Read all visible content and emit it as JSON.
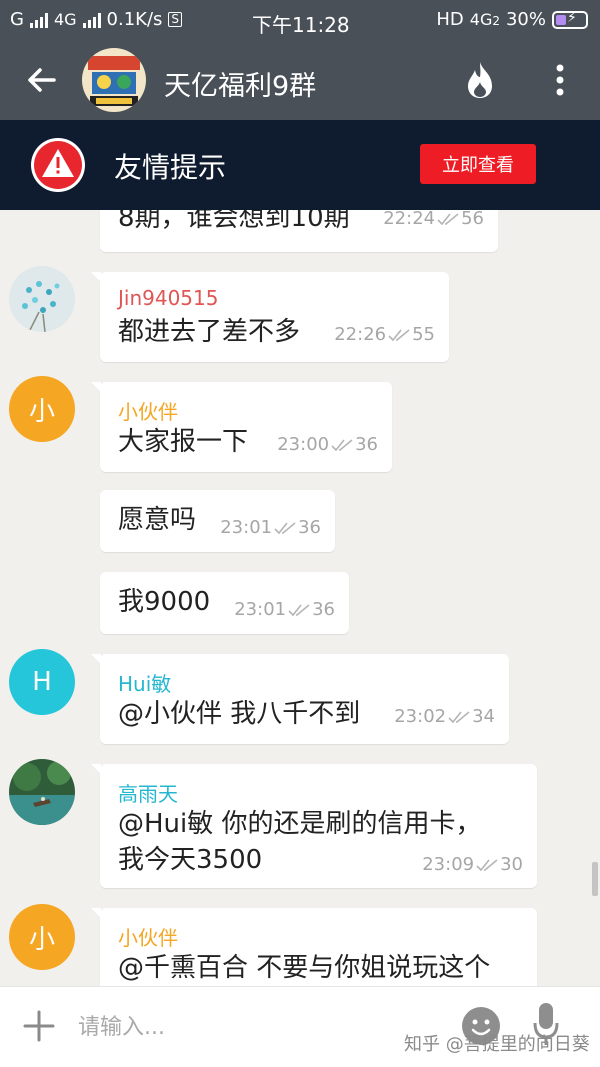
{
  "status_bar": {
    "carrier1": "G",
    "carrier2": "4G",
    "speed": "0.1K/s",
    "s_badge": "S",
    "time": "下午11:28",
    "hd": "HD",
    "net": "4G",
    "sub": "2",
    "battery": "30%"
  },
  "header": {
    "title": "天亿福利9群"
  },
  "alert": {
    "title": "友情提示",
    "button": "立即查看"
  },
  "messages": [
    {
      "text": "8期，谁会想到10期",
      "time": "22:24",
      "reads": "56"
    },
    {
      "sender": "Jin940515",
      "sender_color": "#e05555",
      "text": "都进去了差不多",
      "time": "22:26",
      "reads": "55"
    },
    {
      "avatar_letter": "小",
      "avatar_color": "#f5a623",
      "sender": "小伙伴",
      "sender_color": "#f5a623",
      "text": "大家报一下",
      "time": "23:00",
      "reads": "36"
    },
    {
      "text": "愿意吗",
      "time": "23:01",
      "reads": "36"
    },
    {
      "text": "我9000",
      "time": "23:01",
      "reads": "36"
    },
    {
      "avatar_letter": "H",
      "avatar_color": "#26c6da",
      "sender": "Hui敏",
      "sender_color": "#26b7d0",
      "text": "@小伙伴 我八千不到",
      "time": "23:02",
      "reads": "34"
    },
    {
      "sender": "高雨天",
      "sender_color": "#26b7d0",
      "line1": "@Hui敏 你的还是刷的信用卡，",
      "line2": "我今天3500",
      "time": "23:09",
      "reads": "30"
    },
    {
      "avatar_letter": "小",
      "avatar_color": "#f5a623",
      "sender": "小伙伴",
      "sender_color": "#f5a623",
      "text": "@千熏百合 不要与你姐说玩这个"
    }
  ],
  "input": {
    "placeholder": "请输入..."
  },
  "watermark": "知乎 @菩提里的向日葵",
  "icons": [
    "back-arrow-icon",
    "fire-icon",
    "more-vertical-icon",
    "warning-icon",
    "double-check-icon",
    "plus-icon",
    "emoji-icon",
    "mic-icon"
  ]
}
